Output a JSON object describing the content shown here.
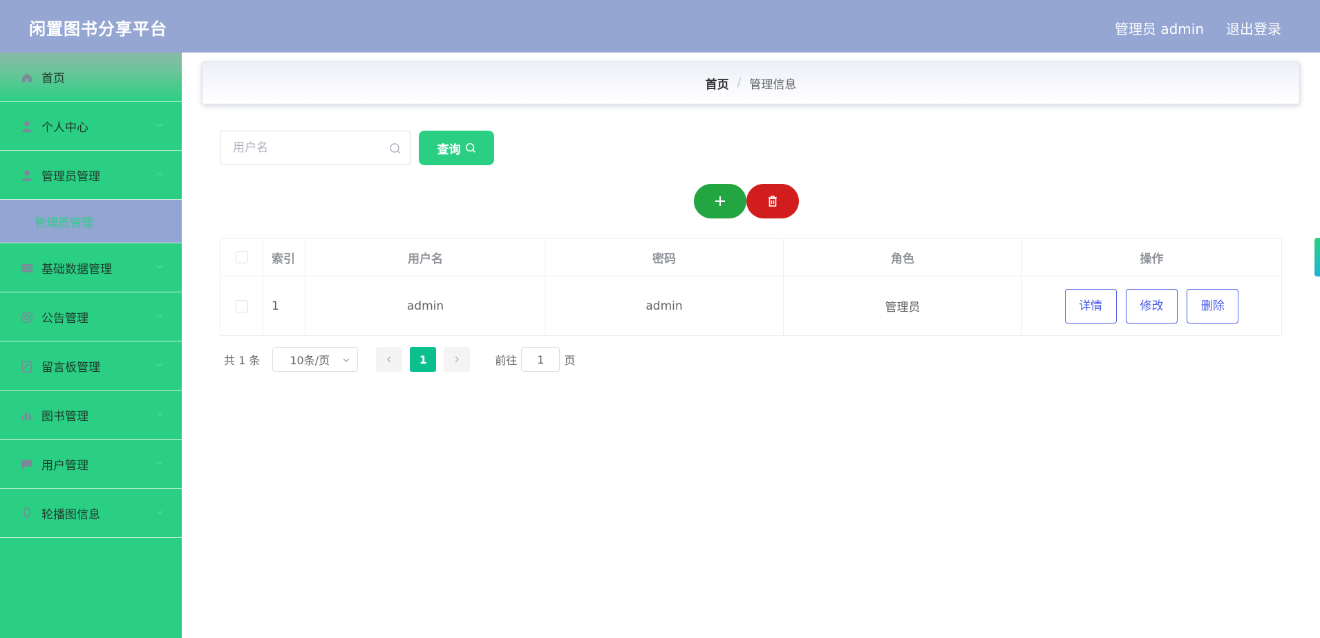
{
  "header": {
    "title": "闲置图书分享平台",
    "user_label": "管理员 admin",
    "logout_label": "退出登录"
  },
  "sidebar": {
    "items": [
      {
        "label": "首页",
        "icon": "home-icon"
      },
      {
        "label": "个人中心",
        "icon": "user-icon"
      },
      {
        "label": "管理员管理",
        "icon": "user-icon"
      },
      {
        "label": "管理员管理",
        "icon": "none",
        "sub": true
      },
      {
        "label": "基础数据管理",
        "icon": "grid-icon"
      },
      {
        "label": "公告管理",
        "icon": "notice-icon"
      },
      {
        "label": "留言板管理",
        "icon": "message-icon"
      },
      {
        "label": "图书管理",
        "icon": "chart-icon"
      },
      {
        "label": "用户管理",
        "icon": "flag-icon"
      },
      {
        "label": "轮播图信息",
        "icon": "image-icon"
      }
    ]
  },
  "breadcrumb": {
    "home": "首页",
    "separator": "/",
    "current": "管理信息"
  },
  "search": {
    "placeholder": "用户名",
    "query_label": "查询"
  },
  "table": {
    "headers": [
      "索引",
      "用户名",
      "密码",
      "角色",
      "操作"
    ],
    "rows": [
      {
        "index": "1",
        "username": "admin",
        "password": "admin",
        "role": "管理员"
      }
    ],
    "actions": [
      "详情",
      "修改",
      "删除"
    ]
  },
  "pagination": {
    "total": "共 1 条",
    "page_size": "10条/页",
    "current_page": "1",
    "goto_label": "前往",
    "goto_value": "1",
    "page_unit": "页"
  },
  "colors": {
    "header_bg": "#95a6d2",
    "sidebar_bg": "#2bcf84",
    "add_button": "#23a642",
    "delete_button": "#d11d1d",
    "action_border": "#4a5be8"
  }
}
